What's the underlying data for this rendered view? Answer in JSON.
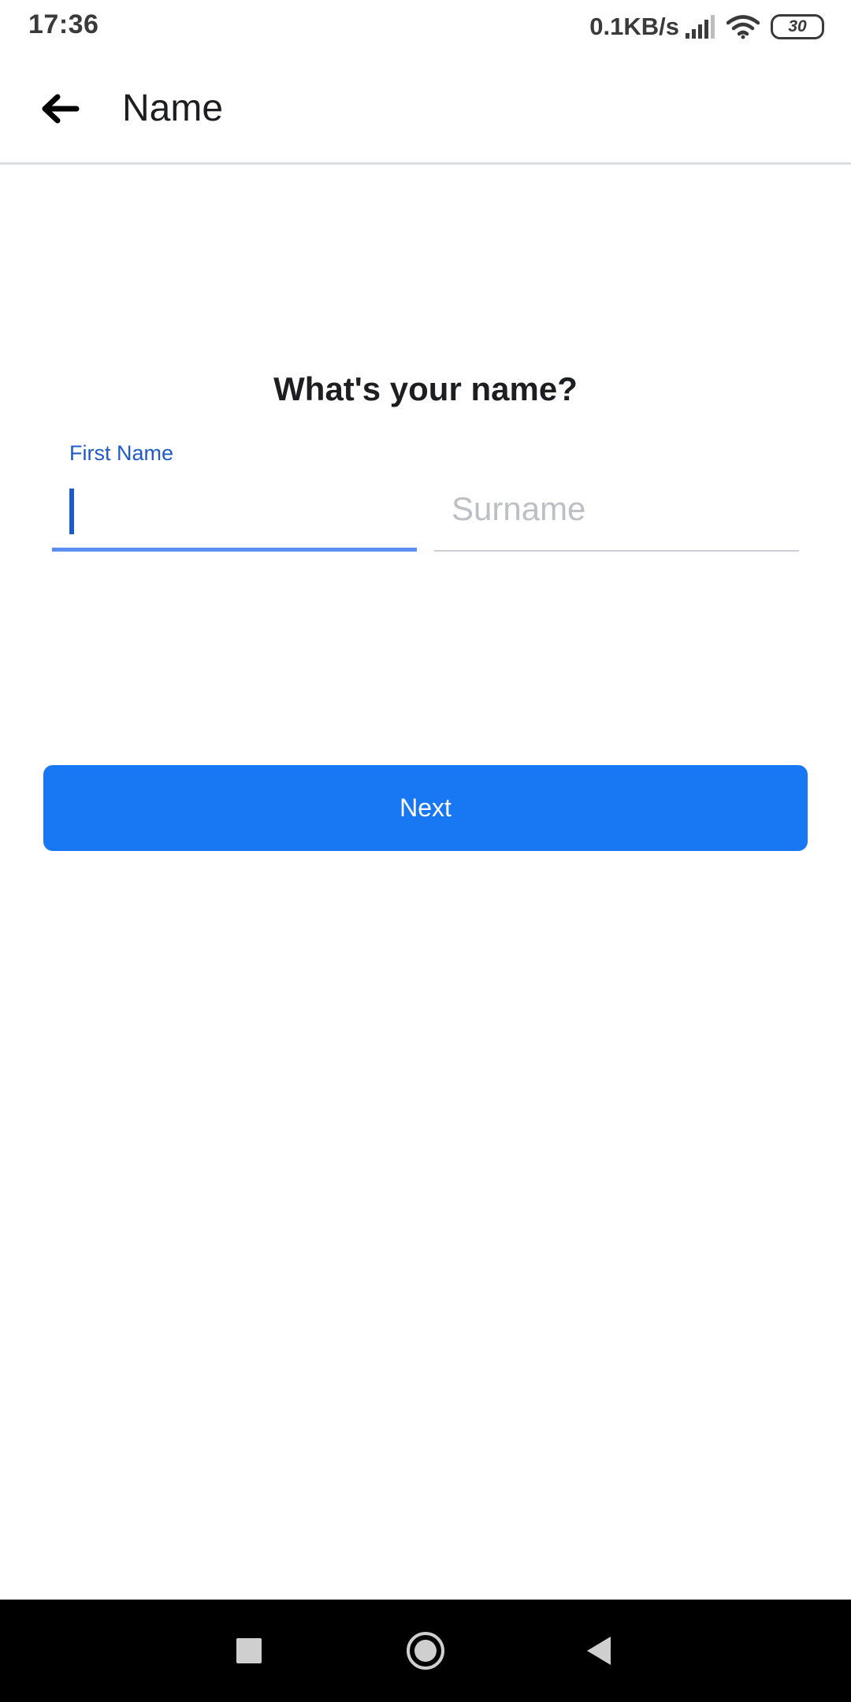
{
  "status_bar": {
    "time": "17:36",
    "net_speed": "0.1KB/s",
    "battery_level": "30",
    "icons": [
      "signal-icon",
      "wifi-icon",
      "battery-icon"
    ]
  },
  "app_bar": {
    "title": "Name",
    "back_icon": "back-arrow-icon"
  },
  "form": {
    "question": "What's your name?",
    "first_name": {
      "label": "First Name",
      "value": ""
    },
    "surname": {
      "placeholder": "Surname",
      "value": ""
    },
    "next_label": "Next"
  },
  "nav_bar": {
    "icons": [
      "recents-square-icon",
      "home-circle-icon",
      "back-triangle-icon"
    ]
  },
  "colors": {
    "accent": "#1877f2",
    "label_active": "#1f5bc4",
    "underline_active": "#5b8ef0",
    "placeholder": "#bcc0c4",
    "nav_background": "#000000"
  }
}
